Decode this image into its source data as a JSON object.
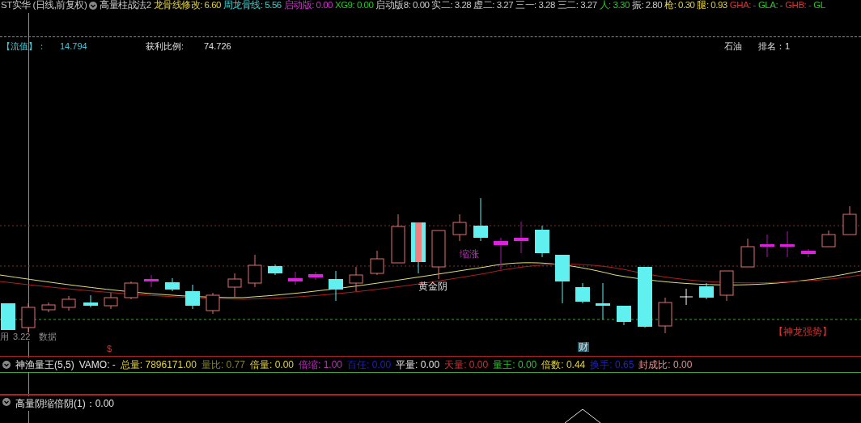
{
  "header": {
    "title": "ST实华 (日线,前复权)",
    "formula": "高量柱战法2",
    "indicators": [
      {
        "label": "龙骨线修改:",
        "value": "6.60",
        "color": "#e0d040"
      },
      {
        "label": "周龙骨线:",
        "value": "5.56",
        "color": "#40d0d0"
      },
      {
        "label": "启动版:",
        "value": "0.00",
        "color": "#d030d0"
      },
      {
        "label": "XG9:",
        "value": "0.00",
        "color": "#30c030"
      },
      {
        "label": "启动版8:",
        "value": "0.00",
        "color": "#c8c8c8"
      },
      {
        "label": "实二:",
        "value": "3.28",
        "color": "#c8c8c8"
      },
      {
        "label": "虚二:",
        "value": "3.27",
        "color": "#c8c8c8"
      },
      {
        "label": "三一:",
        "value": "3.28",
        "color": "#c8c8c8"
      },
      {
        "label": "三二:",
        "value": "3.27",
        "color": "#c8c8c8"
      },
      {
        "label": "人:",
        "value": "3.30",
        "color": "#30c030"
      },
      {
        "label": "振:",
        "value": "2.80",
        "color": "#c8c8c8"
      },
      {
        "label": "枪:",
        "value": "0.30",
        "color": "#e0d040"
      },
      {
        "label": "腿:",
        "value": "0.93",
        "color": "#e0d040"
      },
      {
        "label": "GHA:",
        "value": "-",
        "color": "#e03030"
      },
      {
        "label": "GLA:",
        "value": "-",
        "color": "#30c030"
      },
      {
        "label": "GHB:",
        "value": "-",
        "color": "#e03030"
      },
      {
        "label": "GL",
        "color": "#30c030"
      }
    ]
  },
  "info": {
    "float_label": "【流值】：",
    "float_value": "14.794",
    "profit_label": "获利比例:",
    "profit_value": "74.726",
    "sector": "石油",
    "rank": "排名：1"
  },
  "chart_labels": [
    {
      "text": "用",
      "kind": "plain"
    },
    {
      "text": "3.22",
      "kind": "plain"
    },
    {
      "text": "数据",
      "kind": "plain"
    },
    {
      "text": "$",
      "kind": "marker"
    },
    {
      "text": "缩涨",
      "kind": "signal"
    },
    {
      "text": "黄金阴",
      "kind": "note"
    },
    {
      "text": "财",
      "kind": "badge"
    },
    {
      "text": "【神龙强势】",
      "kind": "alert"
    }
  ],
  "volume_panel": {
    "title": "神渔量王(5,5)",
    "indicators": [
      {
        "label": "VAMO:",
        "value": "-",
        "color": "#e0e0e0"
      },
      {
        "label": "总量:",
        "value": "7896171.00",
        "color": "#e0d040"
      },
      {
        "label": "量比:",
        "value": "0.77",
        "color": "#808030"
      },
      {
        "label": "倍量:",
        "value": "0.00",
        "color": "#e0d040"
      },
      {
        "label": "倍缩:",
        "value": "1.00",
        "color": "#c030c0"
      },
      {
        "label": "百任:",
        "value": "0.00",
        "color": "#2020c0"
      },
      {
        "label": "平量:",
        "value": "0.00",
        "color": "#e0e0e0"
      },
      {
        "label": "天量:",
        "value": "0.00",
        "color": "#d03030"
      },
      {
        "label": "量王:",
        "value": "0.00",
        "color": "#30c030"
      },
      {
        "label": "倍数:",
        "value": "0.44",
        "color": "#e0d040"
      },
      {
        "label": "换手:",
        "value": "0.65",
        "color": "#2020c0"
      },
      {
        "label": "封成比:",
        "value": "0.00",
        "color": "#e09090"
      }
    ]
  },
  "bottom_panel": {
    "title": "高量阴缩倍阴(1)：0.00"
  }
}
